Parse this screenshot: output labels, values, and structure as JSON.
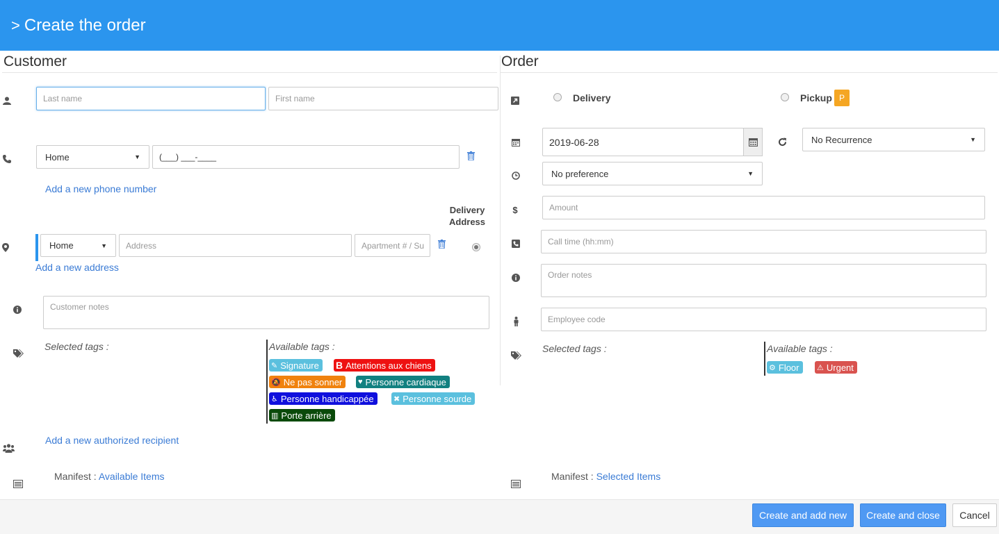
{
  "header": {
    "chevron": ">",
    "title": "Create the order"
  },
  "customer": {
    "title": "Customer",
    "last_name_placeholder": "Last name",
    "first_name_placeholder": "First name",
    "phone": {
      "type": "Home",
      "mask": "(___) ___-____"
    },
    "add_phone": "Add a new phone number",
    "delivery_address_label": "Delivery Address",
    "address": {
      "type": "Home",
      "address_placeholder": "Address",
      "apartment_placeholder": "Apartment # / Su"
    },
    "add_address": "Add a new address",
    "notes_placeholder": "Customer notes",
    "selected_tags_label": "Selected tags :",
    "available_tags_label": "Available tags :",
    "tags": [
      {
        "label": "Signature",
        "icon": "✎",
        "color": "#5bc0de"
      },
      {
        "label": "Attentions aux chiens",
        "icon": "B",
        "color": "#ee1111"
      },
      {
        "label": "Ne pas sonner",
        "icon": "🔕",
        "color": "#f0820e"
      },
      {
        "label": "Personne cardiaque",
        "icon": "♥",
        "color": "#128080"
      },
      {
        "label": "Personne handicappée",
        "icon": "♿",
        "color": "#1010dd"
      },
      {
        "label": "Personne sourde",
        "icon": "✖",
        "color": "#5bc0de"
      },
      {
        "label": "Porte arrière",
        "icon": "▥",
        "color": "#0a4a0a"
      }
    ],
    "add_recipient": "Add a new authorized recipient",
    "manifest_label": "Manifest :",
    "manifest_link": "Available Items"
  },
  "order": {
    "title": "Order",
    "delivery_label": "Delivery",
    "pickup_label": "Pickup",
    "pickup_badge": "P",
    "date_value": "2019-06-28",
    "recurrence": "No Recurrence",
    "time_pref": "No preference",
    "amount_placeholder": "Amount",
    "call_time_placeholder": "Call time (hh:mm)",
    "notes_placeholder": "Order notes",
    "employee_placeholder": "Employee code",
    "selected_tags_label": "Selected tags :",
    "available_tags_label": "Available tags :",
    "tags": [
      {
        "label": "Floor",
        "icon": "⚙",
        "color": "#5bc0de"
      },
      {
        "label": "Urgent",
        "icon": "⚠",
        "color": "#d9534f"
      }
    ],
    "manifest_label": "Manifest :",
    "manifest_link": "Selected Items"
  },
  "footer": {
    "create_add_new": "Create and add new",
    "create_close": "Create and close",
    "cancel": "Cancel"
  }
}
